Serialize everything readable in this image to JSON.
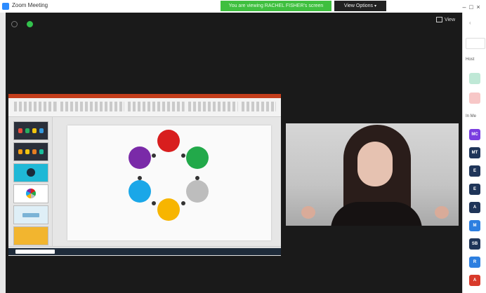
{
  "window": {
    "title": "Zoom Meeting",
    "share_banner": "You are viewing RACHEL FISHER's screen",
    "view_options_label": "View Options",
    "controls": [
      "–",
      "□",
      "×"
    ]
  },
  "meeting": {
    "view_button_label": "View",
    "status_icons": [
      "shield-icon",
      "encryption-icon"
    ]
  },
  "shared_screen": {
    "app": "PowerPoint",
    "diagram_colors": [
      "#d81e1e",
      "#22a94a",
      "#bdbdbd",
      "#f7b500",
      "#1aa7e8",
      "#7a2aa8"
    ]
  },
  "participants_panel": {
    "section_top": "Host",
    "search_hint": "",
    "section_waiting": "In Me",
    "avatars": [
      {
        "label": "",
        "color": "#bfe8d6"
      },
      {
        "label": "",
        "color": "#f7c7c7"
      },
      {
        "label": "MC",
        "color": "#7a3ee0"
      },
      {
        "label": "MT",
        "color": "#1f3559"
      },
      {
        "label": "E",
        "color": "#1f3559"
      },
      {
        "label": "E",
        "color": "#1f3559"
      },
      {
        "label": "A",
        "color": "#1f3559"
      },
      {
        "label": "M",
        "color": "#2d7fe0"
      },
      {
        "label": "SB",
        "color": "#1f3559"
      },
      {
        "label": "R",
        "color": "#2d7fe0"
      },
      {
        "label": "A",
        "color": "#d83a2b"
      }
    ]
  }
}
